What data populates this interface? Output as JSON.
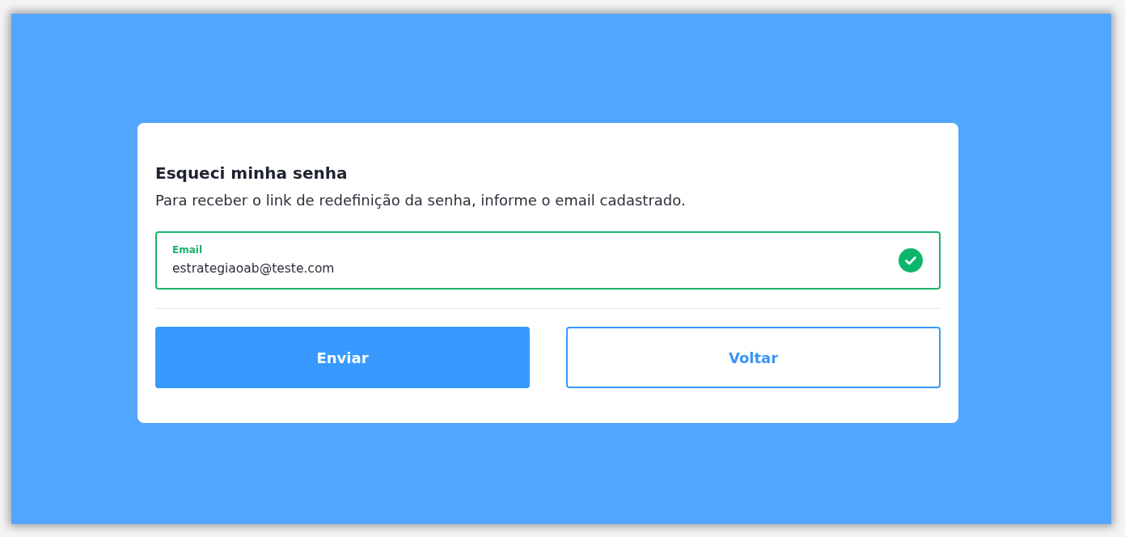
{
  "title": "Esqueci minha senha",
  "subtitle": "Para receber o link de redefinição da senha, informe o email cadastrado.",
  "email_field": {
    "label": "Email",
    "value": "estrategiaoab@teste.com",
    "valid": true
  },
  "buttons": [
    {
      "label": "Enviar",
      "kind": "primary"
    },
    {
      "label": "Voltar",
      "kind": "secondary"
    }
  ]
}
